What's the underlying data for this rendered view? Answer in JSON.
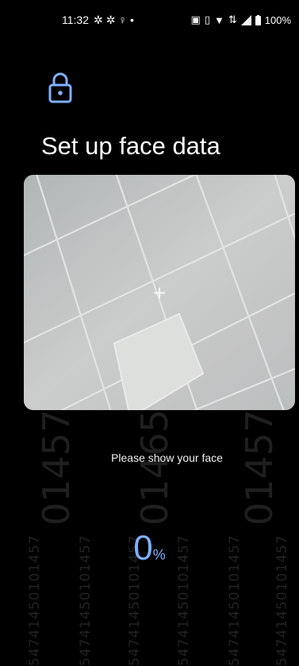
{
  "status_bar": {
    "time": "11:32",
    "left_icons": [
      "gear-icon",
      "gear-icon",
      "bulb-icon",
      "dot-icon"
    ],
    "right_icons": [
      "nfc-icon",
      "vibrate-icon",
      "wifi-icon",
      "data-icon",
      "signal-icon",
      "battery-icon"
    ],
    "battery": "100%"
  },
  "header": {
    "title": "Set up face data",
    "lock_icon": "lock-icon"
  },
  "camera": {
    "crosshair_icon": "plus-icon"
  },
  "instructions": {
    "prompt": "Please show your face"
  },
  "progress": {
    "value": "0",
    "unit": "%",
    "color": "#7fb0ff"
  },
  "watermark": {
    "text": "354741450101457",
    "big_text_1": "01457",
    "big_text_2": "01465",
    "big_text_3": "01457"
  }
}
